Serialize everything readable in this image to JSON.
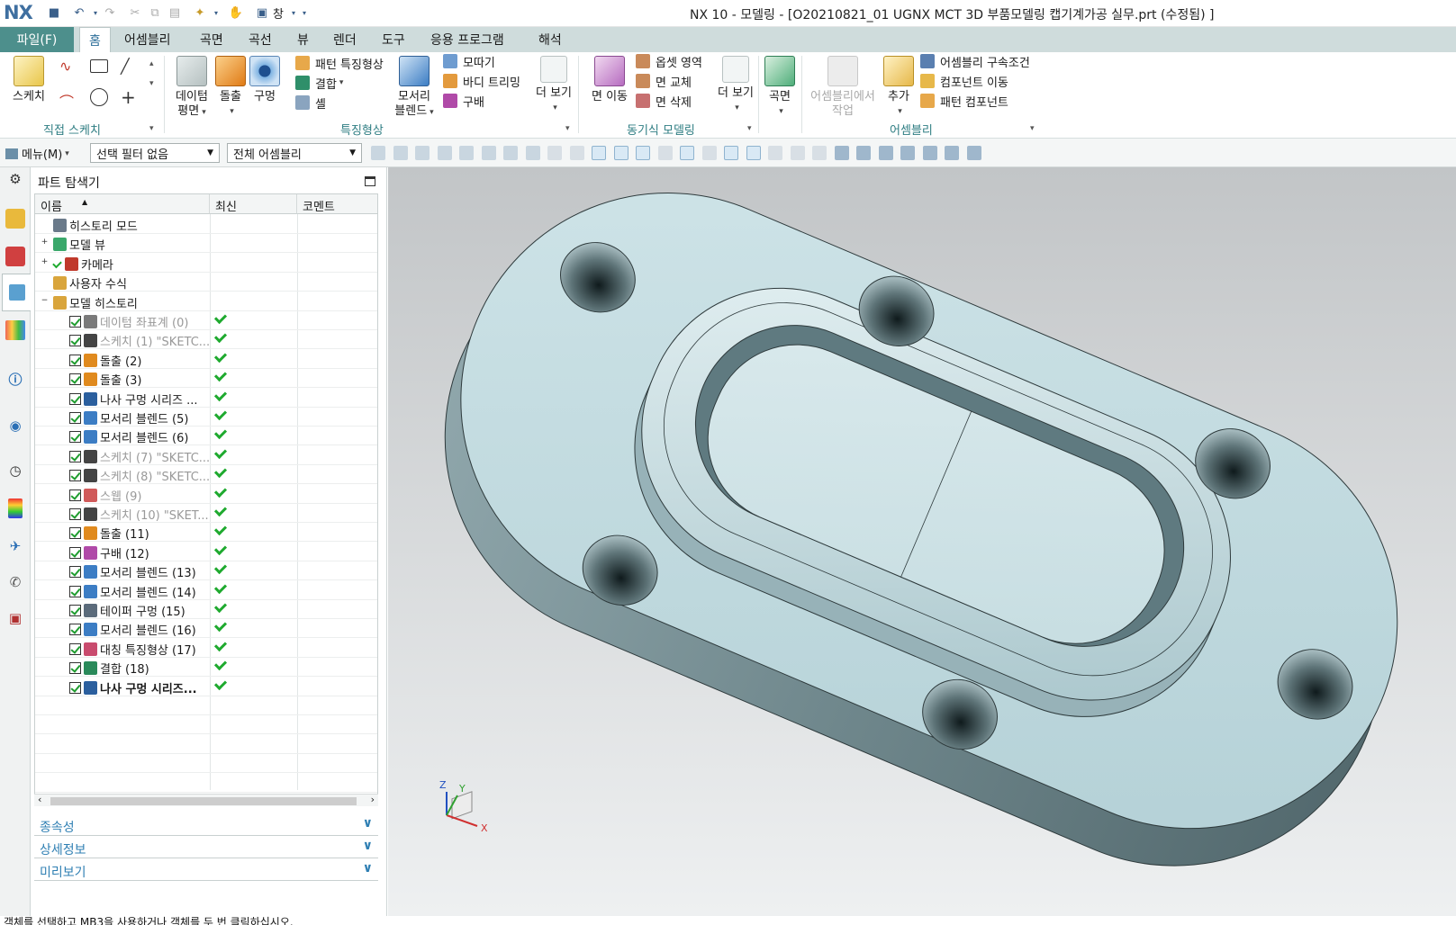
{
  "app": {
    "logo": "NX",
    "title": "NX 10 - 모델링 - [O20210821_01 UGNX MCT 3D 부품모델링 캡기계가공 실무.prt (수정됨) ]",
    "window_menu": "창"
  },
  "tabs": {
    "file": "파일(F)",
    "items": [
      "홈",
      "어셈블리",
      "곡면",
      "곡선",
      "뷰",
      "렌더",
      "도구",
      "응용 프로그램",
      "해석"
    ]
  },
  "ribbon": {
    "sketch_group": {
      "label": "직접 스케치",
      "sketch": "스케치"
    },
    "feature_group": {
      "label": "특징형상",
      "datum": [
        "데이텀",
        "평면"
      ],
      "extrude": "돌출",
      "hole": "구멍",
      "pattern_feature": "패턴 특징형상",
      "unite": "결합",
      "shell": "셸",
      "edge_blend": [
        "모서리",
        "블렌드"
      ],
      "chamfer": "모따기",
      "trim_body": "바디 트리밍",
      "draft": "구배",
      "more": "더 보기"
    },
    "sync_group": {
      "label": "동기식 모델링",
      "move_face": "면 이동",
      "offset_region": "옵셋 영역",
      "replace_face": "면 교체",
      "delete_face": "면 삭제",
      "more": "더 보기"
    },
    "surface_group": {
      "surface": "곡면"
    },
    "assembly_group": {
      "label": "어셈블리",
      "work_in_assembly": [
        "어셈블리에서",
        "작업"
      ],
      "add": "추가",
      "constraints": "어셈블리 구속조건",
      "move_component": "컴포넌트 이동",
      "pattern_component": "패턴 컴포넌트"
    }
  },
  "selection_bar": {
    "menu": "메뉴(M)",
    "filter": "선택 필터 없음",
    "scope": "전체 어셈블리"
  },
  "navigator": {
    "title": "파트 탐색기",
    "columns": [
      "이름",
      "최신",
      "코멘트"
    ],
    "nodes": [
      {
        "name": "히스토리 모드",
        "icon_color": "#6a7a8a",
        "indent": 0,
        "kind": "top"
      },
      {
        "name": "모델 뷰",
        "icon_color": "#3aa86b",
        "indent": 0,
        "kind": "top",
        "expander": "+"
      },
      {
        "name": "카메라",
        "icon_color": "#c0392b",
        "indent": 0,
        "kind": "top",
        "expander": "+",
        "check": true
      },
      {
        "name": "사용자 수식",
        "icon_color": "#d9a53c",
        "indent": 0,
        "kind": "top"
      },
      {
        "name": "모델 히스토리",
        "icon_color": "#d9a53c",
        "indent": 0,
        "kind": "top",
        "expander": "−"
      }
    ],
    "features": [
      {
        "name": "데이텀 좌표계 (0)",
        "dim": true,
        "icon_color": "#7a7a7a"
      },
      {
        "name": "스케치 (1) \"SKETC...",
        "dim": true,
        "icon_color": "#444444"
      },
      {
        "name": "돌출 (2)",
        "icon_color": "#e08a1e"
      },
      {
        "name": "돌출 (3)",
        "icon_color": "#e08a1e"
      },
      {
        "name": "나사 구멍 시리즈 ...",
        "icon_color": "#2b5f9e"
      },
      {
        "name": "모서리 블렌드 (5)",
        "icon_color": "#3c7dc4"
      },
      {
        "name": "모서리 블렌드 (6)",
        "icon_color": "#3c7dc4"
      },
      {
        "name": "스케치 (7) \"SKETC...",
        "dim": true,
        "icon_color": "#444444"
      },
      {
        "name": "스케치 (8) \"SKETC...",
        "dim": true,
        "icon_color": "#444444"
      },
      {
        "name": "스웹 (9)",
        "dim": true,
        "icon_color": "#d05a5a"
      },
      {
        "name": "스케치 (10) \"SKET...",
        "dim": true,
        "icon_color": "#444444"
      },
      {
        "name": "돌출 (11)",
        "icon_color": "#e08a1e"
      },
      {
        "name": "구배 (12)",
        "icon_color": "#b04aa8"
      },
      {
        "name": "모서리 블렌드 (13)",
        "icon_color": "#3c7dc4"
      },
      {
        "name": "모서리 블렌드 (14)",
        "icon_color": "#3c7dc4"
      },
      {
        "name": "테이퍼 구멍 (15)",
        "icon_color": "#5b6b7b"
      },
      {
        "name": "모서리 블렌드 (16)",
        "icon_color": "#3c7dc4"
      },
      {
        "name": "대칭 특징형상 (17)",
        "icon_color": "#c94b6e"
      },
      {
        "name": "결합 (18)",
        "icon_color": "#2a8a5a"
      },
      {
        "name": "나사 구멍 시리즈...",
        "bold": true,
        "icon_color": "#2b5f9e"
      }
    ],
    "panels": [
      "종속성",
      "상세정보",
      "미리보기"
    ]
  },
  "triad": {
    "x": "X",
    "y": "Y",
    "z": "Z"
  },
  "status_text": "객체를 선택하고 MB3을 사용하거나 객체를 두 번 클릭하십시오.",
  "colors": {
    "accent": "#4d8f8c",
    "group_label": "#2f7e83",
    "panel_link": "#2f7fb3",
    "model": "#bfdadf",
    "model_side": "#8fa9ae",
    "check": "#1f9c2f"
  }
}
